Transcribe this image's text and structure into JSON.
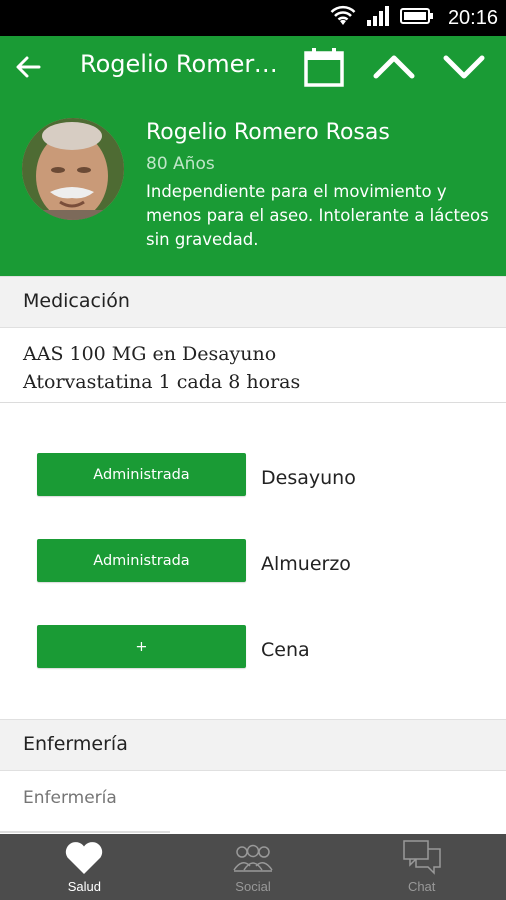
{
  "status_bar": {
    "time": "20:16"
  },
  "app_bar": {
    "title": "Rogelio Romero Rosas"
  },
  "patient": {
    "name": "Rogelio Romero Rosas",
    "age": "80 Años",
    "description": "Independiente para el movimiento y menos para el aseo. Intolerante a lácteos sin gravedad."
  },
  "medication": {
    "header": "Medicación",
    "lines": [
      "AAS 100 MG en Desayuno",
      "Atorvastatina 1 cada 8 horas"
    ],
    "doses": [
      {
        "button": "Administrada",
        "meal": "Desayuno"
      },
      {
        "button": "Administrada",
        "meal": "Almuerzo"
      },
      {
        "button": "+",
        "meal": "Cena"
      }
    ]
  },
  "nursing": {
    "header": "Enfermería",
    "placeholder": "Enfermería"
  },
  "bottom_nav": {
    "items": [
      {
        "label": "Salud",
        "icon": "heart-icon",
        "active": true
      },
      {
        "label": "Social",
        "icon": "people-icon",
        "active": false
      },
      {
        "label": "Chat",
        "icon": "chat-icon",
        "active": false
      }
    ]
  },
  "colors": {
    "primary": "#1a9b35",
    "nav_bg": "#4c4c4c"
  }
}
